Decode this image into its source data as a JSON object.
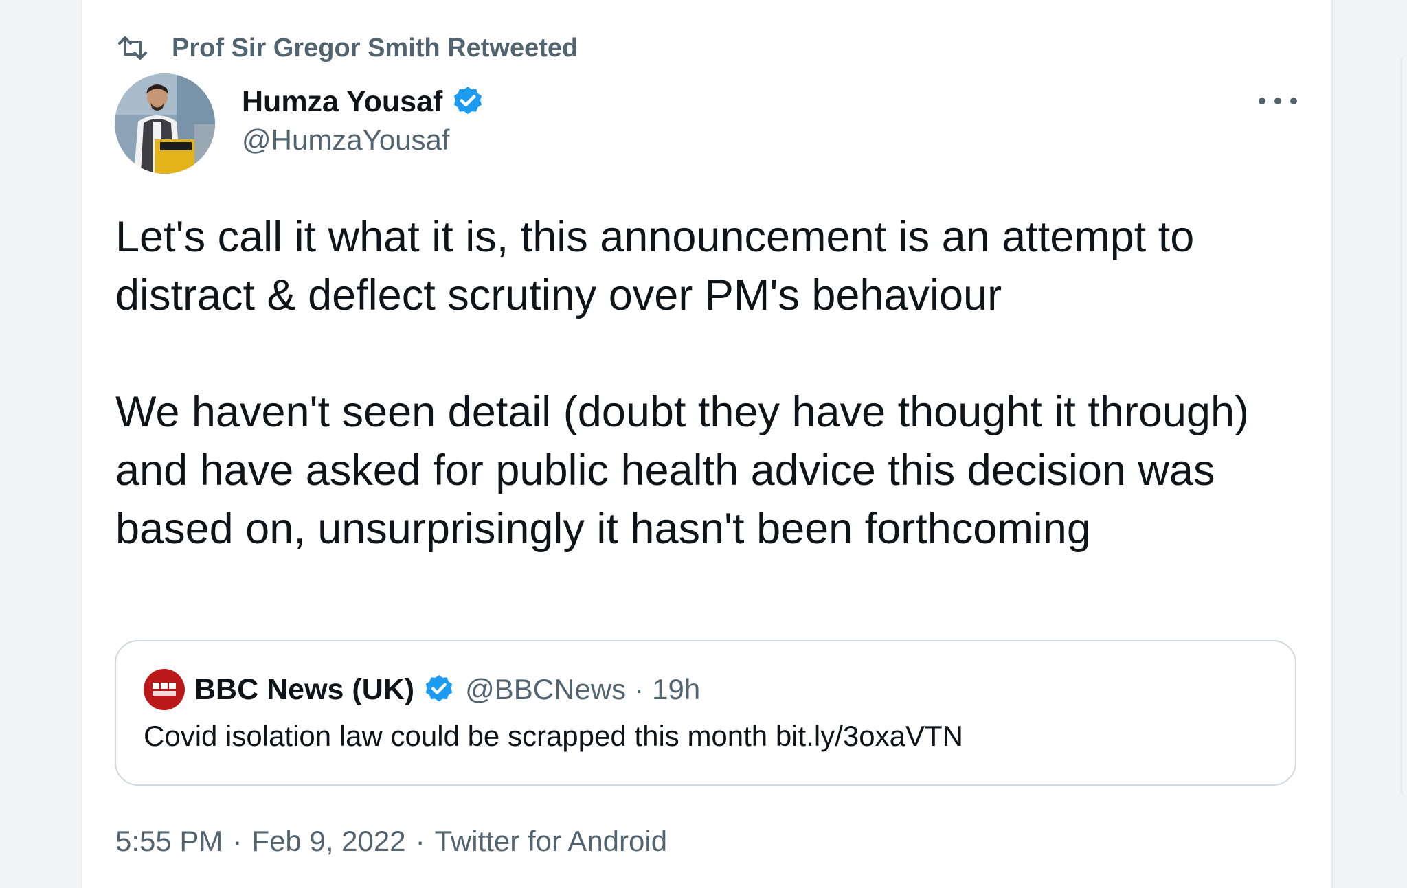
{
  "retweet": {
    "label": "Prof Sir Gregor Smith Retweeted",
    "icon": "retweet-icon"
  },
  "author": {
    "name": "Humza Yousaf",
    "handle": "@HumzaYousaf",
    "verified": true
  },
  "tweet": {
    "paragraph_1": "Let's call it what it is, this announcement is an attempt to distract & deflect scrutiny over PM's behaviour",
    "paragraph_2": "We haven't seen detail (doubt they have thought it through) and have asked for public health advice this decision was based on, unsurprisingly it hasn't been forthcoming"
  },
  "quote": {
    "name": "BBC News (UK)",
    "verified": true,
    "handle": "@BBCNews",
    "separator": "·",
    "time": "19h",
    "text": "Covid isolation law could be scrapped this month bit.ly/3oxaVTN"
  },
  "meta": {
    "time": "5:55 PM",
    "separator_1": "·",
    "date": "Feb 9, 2022",
    "separator_2": "·",
    "source": "Twitter for Android"
  },
  "colors": {
    "verified_blue": "#1d9bf0",
    "bbc_red": "#bb1919",
    "secondary_text": "#536471",
    "primary_text": "#0f1419"
  }
}
